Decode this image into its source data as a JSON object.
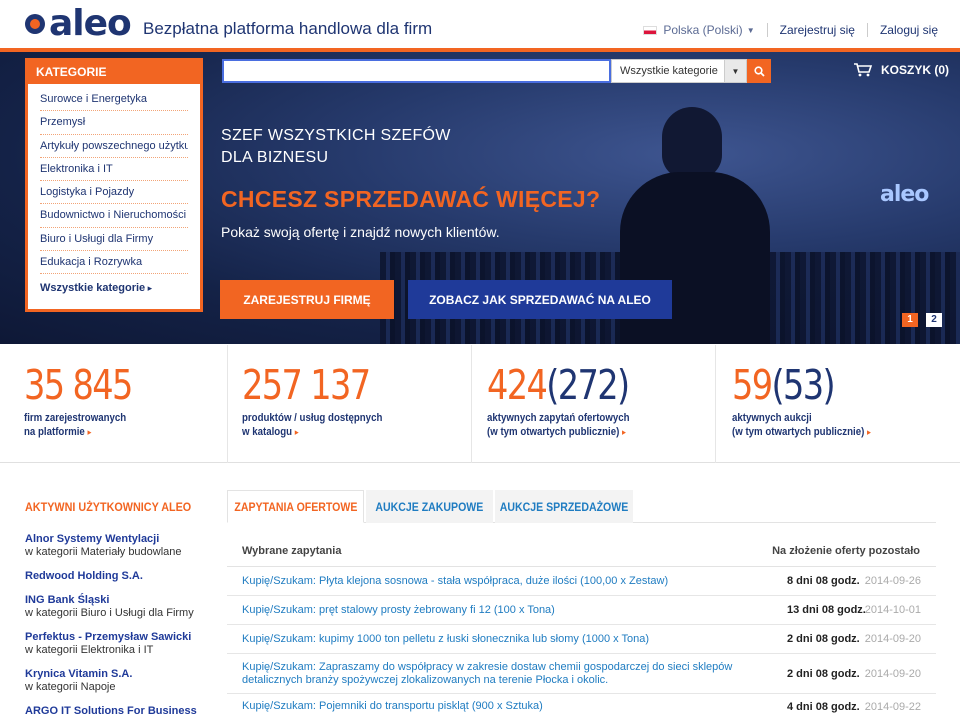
{
  "header": {
    "logo_text": "aleo",
    "tagline": "Bezpłatna platforma handlowa dla firm",
    "language": "Polska (Polski)",
    "register_link": "Zarejestruj się",
    "login_link": "Zaloguj się"
  },
  "categories": {
    "title": "KATEGORIE",
    "items": [
      "Surowce i Energetyka",
      "Przemysł",
      "Artykuły powszechnego użytku",
      "Elektronika i IT",
      "Logistyka i Pojazdy",
      "Budownictwo i Nieruchomości",
      "Biuro i Usługi dla Firmy",
      "Edukacja i Rozrywka"
    ],
    "all_link": "Wszystkie kategorie"
  },
  "search": {
    "value": "",
    "category_selected": "Wszystkie kategorie"
  },
  "cart": {
    "label": "KOSZYK (0)"
  },
  "hero": {
    "heading_line1": "SZEF WSZYSTKICH SZEFÓW",
    "heading_line2": "DLA BIZNESU",
    "headline": "CHCESZ SPRZEDAWAĆ WIĘCEJ?",
    "subtext": "Pokaż swoją ofertę i znajdź nowych klientów.",
    "btn_register": "ZAREJESTRUJ FIRMĘ",
    "btn_howto": "ZOBACZ JAK SPRZEDAWAĆ NA ALEO",
    "screen_logo": "aleo",
    "slides": [
      "1",
      "2"
    ]
  },
  "stats": [
    {
      "value": "35 845",
      "paren": "",
      "line1": "firm zarejestrowanych",
      "line2": "na platformie"
    },
    {
      "value": "257 137",
      "paren": "",
      "line1": "produktów / usług dostępnych",
      "line2": "w katalogu"
    },
    {
      "value": "424",
      "paren": "(272)",
      "line1": "aktywnych zapytań ofertowych",
      "line2": "(w tym otwartych publicznie)"
    },
    {
      "value": "59",
      "paren": "(53)",
      "line1": "aktywnych aukcji",
      "line2": "(w tym otwartych publicznie)"
    }
  ],
  "active_users": {
    "title": "AKTYWNI UŻYTKOWNICY ALEO",
    "items": [
      {
        "name": "Alnor Systemy Wentylacji",
        "category": "w kategorii Materiały budowlane"
      },
      {
        "name": "Redwood Holding S.A.",
        "category": ""
      },
      {
        "name": "ING Bank Śląski",
        "category": "w kategorii Biuro i Usługi dla Firmy"
      },
      {
        "name": "Perfektus - Przemysław Sawicki",
        "category": "w kategorii Elektronika i IT"
      },
      {
        "name": "Krynica Vitamin S.A.",
        "category": "w kategorii Napoje"
      },
      {
        "name": "ARGO IT Solutions For Business",
        "category": ""
      }
    ]
  },
  "tabs": [
    "ZAPYTANIA OFERTOWE",
    "AUKCJE ZAKUPOWE",
    "AUKCJE SPRZEDAŻOWE"
  ],
  "table": {
    "col_left": "Wybrane zapytania",
    "col_right": "Na złożenie oferty pozostało",
    "rows": [
      {
        "title": "Kupię/Szukam: Płyta klejona sosnowa - stała współpraca, duże ilości (100,00 x Zestaw)",
        "time": "8 dni 08 godz.",
        "date": "2014-09-26"
      },
      {
        "title": "Kupię/Szukam: pręt stalowy prosty żebrowany fi 12 (100 x Tona)",
        "time": "13 dni 08 godz.",
        "date": "2014-10-01"
      },
      {
        "title": "Kupię/Szukam: kupimy 1000 ton pelletu z łuski słonecznika lub słomy (1000 x Tona)",
        "time": "2 dni 08 godz.",
        "date": "2014-09-20"
      },
      {
        "title": "Kupię/Szukam: Zapraszamy do współpracy w zakresie dostaw chemii gospodarczej do sieci sklepów detalicznych branży spożywczej zlokalizowanych na terenie Płocka i okolic.",
        "time": "2 dni 08 godz.",
        "date": "2014-09-20"
      },
      {
        "title": "Kupię/Szukam: Pojemniki do transportu piskląt (900 x Sztuka)",
        "time": "4 dni 08 godz.",
        "date": "2014-09-22"
      }
    ]
  },
  "colors": {
    "brand_orange": "#f26522",
    "brand_navy": "#1f3572",
    "link_blue": "#1f7cc1"
  }
}
